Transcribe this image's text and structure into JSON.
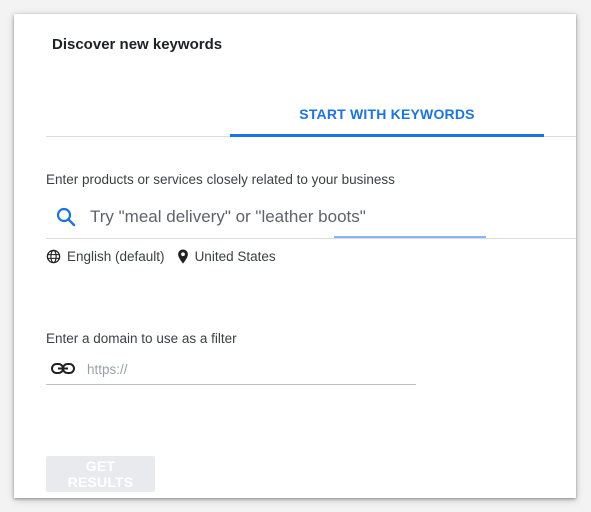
{
  "header": {
    "title": "Discover new keywords"
  },
  "tabs": [
    {
      "label": "START WITH KEYWORDS",
      "active": true
    }
  ],
  "keywords": {
    "label": "Enter products or services closely related to your business",
    "placeholder": "Try \"meal delivery\" or \"leather boots\"",
    "value": "",
    "icon": "search-icon"
  },
  "targeting": {
    "language": "English (default)",
    "language_icon": "globe-icon",
    "location": "United States",
    "location_icon": "location-pin-icon"
  },
  "domain": {
    "label": "Enter a domain to use as a filter",
    "placeholder": "https://",
    "value": "",
    "icon": "link-icon"
  },
  "actions": {
    "get_results_label": "GET RESULTS",
    "enabled": false
  },
  "colors": {
    "accent": "#1a73e8",
    "disabled_button": "#e8eaed",
    "text": "#202124"
  }
}
